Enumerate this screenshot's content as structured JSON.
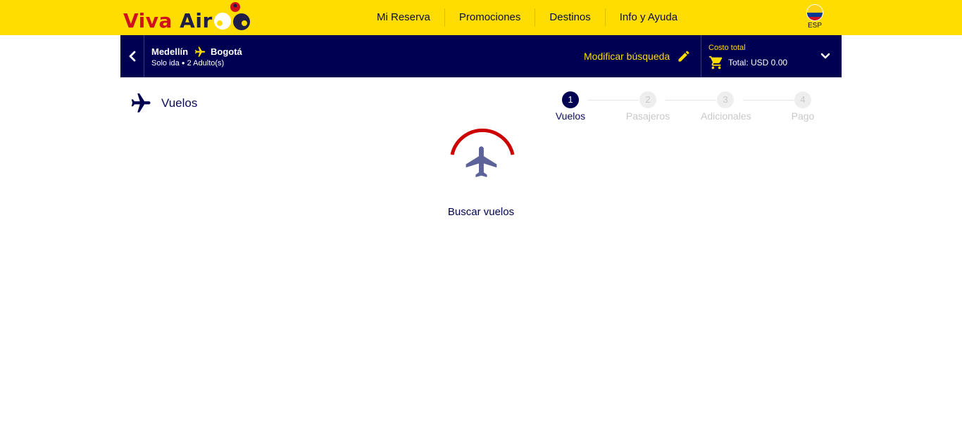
{
  "header": {
    "logo": {
      "brand_word1": "Viva",
      "brand_word2": "Air",
      "brand_color": "#d0101b",
      "text_color": "#1e1e46"
    },
    "nav": [
      {
        "label": "Mi Reserva"
      },
      {
        "label": "Promociones"
      },
      {
        "label": "Destinos"
      },
      {
        "label": "Info y Ayuda"
      }
    ],
    "language": {
      "label": "ESP",
      "flag": "colombia-flag-icon"
    },
    "background_color": "#ffdd00"
  },
  "summary": {
    "back_icon": "chevron-left-icon",
    "origin": "Medellín",
    "destination": "Bogotá",
    "trip_type": "Solo ida",
    "passengers": "2 Adulto(s)",
    "modify_label": "Modificar búsqueda",
    "modify_icon": "pencil-icon",
    "cost_label": "Costo total",
    "cost_total": "Total: USD 0.00",
    "cart_icon": "cart-icon",
    "expand_icon": "chevron-down-icon",
    "background_color": "#000052",
    "accent_color": "#ffdd00"
  },
  "section": {
    "title": "Vuelos",
    "icon": "airplane-icon"
  },
  "steps": [
    {
      "number": "1",
      "label": "Vuelos",
      "state": "active"
    },
    {
      "number": "2",
      "label": "Pasajeros",
      "state": "pending"
    },
    {
      "number": "3",
      "label": "Adicionales",
      "state": "pending"
    },
    {
      "number": "4",
      "label": "Pago",
      "state": "pending"
    }
  ],
  "loader": {
    "text": "Buscar vuelos",
    "icon": "airplane-icon",
    "spinner_color": "#cc0000"
  }
}
